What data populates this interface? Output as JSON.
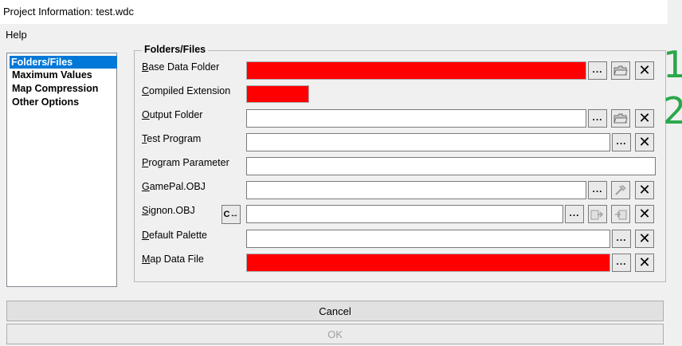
{
  "window": {
    "title": "Project Information: test.wdc"
  },
  "menu": {
    "help": "Help"
  },
  "nav": {
    "items": [
      "Folders/Files",
      "Maximum Values",
      "Map Compression",
      "Other Options"
    ]
  },
  "group": {
    "title": "Folders/Files"
  },
  "fields": {
    "base_data_folder": {
      "u": "B",
      "rest": "ase Data Folder",
      "value": ""
    },
    "compiled_extension": {
      "u": "C",
      "rest": "ompiled Extension",
      "value": ""
    },
    "output_folder": {
      "u": "O",
      "rest": "utput Folder",
      "value": ""
    },
    "test_program": {
      "u": "T",
      "rest": "est Program",
      "value": ""
    },
    "program_parameter": {
      "u": "P",
      "rest": "rogram Parameter",
      "value": ""
    },
    "gamepal_obj": {
      "u": "G",
      "rest": "amePal.OBJ",
      "value": ""
    },
    "signon_obj": {
      "u": "S",
      "rest": "ignon.OBJ",
      "value": ""
    },
    "default_palette": {
      "u": "D",
      "rest": "efault Palette",
      "value": ""
    },
    "map_data_file": {
      "u": "M",
      "rest": "ap Data File",
      "value": ""
    }
  },
  "annotations": [
    "1",
    "2"
  ],
  "buttons": {
    "browse": "...",
    "clear": "✕",
    "cancel": "Cancel",
    "ok": "OK",
    "convert": "C↔"
  },
  "colors": {
    "missing_field": "#ff0000",
    "selection": "#0078d7",
    "annotation": "#2aa84a"
  }
}
